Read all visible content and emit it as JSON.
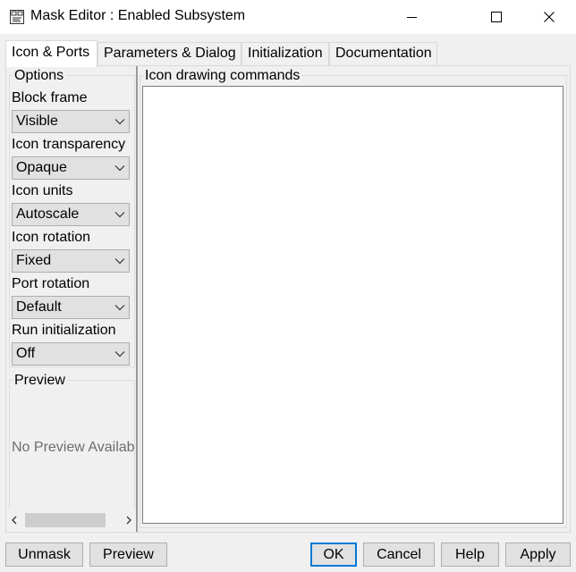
{
  "window": {
    "title": "Mask Editor : Enabled Subsystem",
    "app_icon": "mask-editor-icon",
    "controls": [
      "minimize-icon",
      "maximize-icon",
      "close-icon"
    ]
  },
  "tabs": [
    {
      "label": "Icon & Ports",
      "active": true
    },
    {
      "label": "Parameters & Dialog",
      "active": false
    },
    {
      "label": "Initialization",
      "active": false
    },
    {
      "label": "Documentation",
      "active": false
    }
  ],
  "options": {
    "title": "Options",
    "block_frame": {
      "label": "Block frame",
      "value": "Visible"
    },
    "icon_transparency": {
      "label": "Icon transparency",
      "value": "Opaque"
    },
    "icon_units": {
      "label": "Icon units",
      "value": "Autoscale"
    },
    "icon_rotation": {
      "label": "Icon rotation",
      "value": "Fixed"
    },
    "port_rotation": {
      "label": "Port rotation",
      "value": "Default"
    },
    "run_initialization": {
      "label": "Run initialization",
      "value": "Off"
    }
  },
  "preview": {
    "title": "Preview",
    "placeholder": "No Preview Availab"
  },
  "icon_drawing": {
    "title": "Icon drawing commands",
    "content": ""
  },
  "buttons": {
    "unmask": "Unmask",
    "preview": "Preview",
    "ok": "OK",
    "cancel": "Cancel",
    "help": "Help",
    "apply": "Apply"
  },
  "colors": {
    "background": "#f0f0f0",
    "default_button_border": "#0078d7",
    "control_face": "#e1e1e1"
  }
}
